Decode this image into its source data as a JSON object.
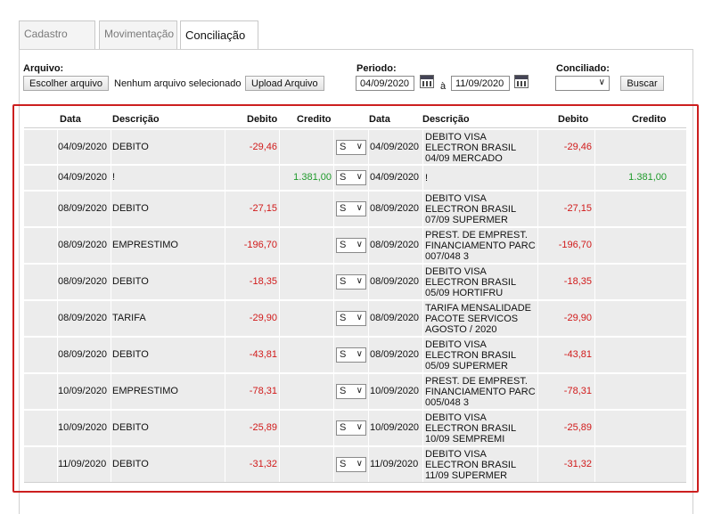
{
  "tabs": [
    {
      "label": "Cadastro",
      "active": false
    },
    {
      "label": "Movimentação",
      "active": false
    },
    {
      "label": "Conciliação",
      "active": true
    }
  ],
  "form": {
    "arquivo_label": "Arquivo:",
    "choose_file_button": "Escolher arquivo",
    "no_file_text": "Nenhum arquivo selecionado",
    "upload_button": "Upload Arquivo",
    "periodo_label": "Periodo:",
    "date_from": "04/09/2020",
    "date_separator": "à",
    "date_to": "11/09/2020",
    "conciliado_label": "Conciliado:",
    "conciliado_value": "",
    "buscar_button": "Buscar"
  },
  "table": {
    "headers": {
      "data": "Data",
      "descricao": "Descrição",
      "debito": "Debito",
      "credito": "Credito",
      "data2": "Data",
      "descricao2": "Descrição",
      "debito2": "Debito",
      "credito2": "Credito"
    },
    "rows": [
      {
        "date": "04/09/2020",
        "desc": "DEBITO",
        "debit": "-29,46",
        "credit": "",
        "match": "S",
        "date2": "04/09/2020",
        "desc2": [
          "DEBITO VISA",
          "ELECTRON BRASIL",
          "04/09 MERCADO"
        ],
        "debit2": "-29,46",
        "credit2": ""
      },
      {
        "date": "04/09/2020",
        "desc": "!",
        "debit": "",
        "credit": "1.381,00",
        "match": "S",
        "date2": "04/09/2020",
        "desc2": [
          "!"
        ],
        "debit2": "",
        "credit2": "1.381,00"
      },
      {
        "date": "08/09/2020",
        "desc": "DEBITO",
        "debit": "-27,15",
        "credit": "",
        "match": "S",
        "date2": "08/09/2020",
        "desc2": [
          "DEBITO VISA",
          "ELECTRON BRASIL",
          "07/09 SUPERMER"
        ],
        "debit2": "-27,15",
        "credit2": ""
      },
      {
        "date": "08/09/2020",
        "desc": "EMPRESTIMO",
        "debit": "-196,70",
        "credit": "",
        "match": "S",
        "date2": "08/09/2020",
        "desc2": [
          "PREST. DE EMPREST.",
          "FINANCIAMENTO PARC",
          "007/048 3"
        ],
        "debit2": "-196,70",
        "credit2": ""
      },
      {
        "date": "08/09/2020",
        "desc": "DEBITO",
        "debit": "-18,35",
        "credit": "",
        "match": "S",
        "date2": "08/09/2020",
        "desc2": [
          "DEBITO VISA",
          "ELECTRON BRASIL",
          "05/09 HORTIFRU"
        ],
        "debit2": "-18,35",
        "credit2": ""
      },
      {
        "date": "08/09/2020",
        "desc": "TARIFA",
        "debit": "-29,90",
        "credit": "",
        "match": "S",
        "date2": "08/09/2020",
        "desc2": [
          "TARIFA MENSALIDADE",
          "PACOTE SERVICOS",
          "AGOSTO / 2020"
        ],
        "debit2": "-29,90",
        "credit2": ""
      },
      {
        "date": "08/09/2020",
        "desc": "DEBITO",
        "debit": "-43,81",
        "credit": "",
        "match": "S",
        "date2": "08/09/2020",
        "desc2": [
          "DEBITO VISA",
          "ELECTRON BRASIL",
          "05/09 SUPERMER"
        ],
        "debit2": "-43,81",
        "credit2": ""
      },
      {
        "date": "10/09/2020",
        "desc": "EMPRESTIMO",
        "debit": "-78,31",
        "credit": "",
        "match": "S",
        "date2": "10/09/2020",
        "desc2": [
          "PREST. DE EMPREST.",
          "FINANCIAMENTO PARC",
          "005/048 3"
        ],
        "debit2": "-78,31",
        "credit2": ""
      },
      {
        "date": "10/09/2020",
        "desc": "DEBITO",
        "debit": "-25,89",
        "credit": "",
        "match": "S",
        "date2": "10/09/2020",
        "desc2": [
          "DEBITO VISA",
          "ELECTRON BRASIL",
          "10/09 SEMPREMI"
        ],
        "debit2": "-25,89",
        "credit2": ""
      },
      {
        "date": "11/09/2020",
        "desc": "DEBITO",
        "debit": "-31,32",
        "credit": "",
        "match": "S",
        "date2": "11/09/2020",
        "desc2": [
          "DEBITO VISA",
          "ELECTRON BRASIL",
          "11/09 SUPERMER"
        ],
        "debit2": "-31,32",
        "credit2": ""
      }
    ]
  },
  "colors": {
    "debit": "#d11a1a",
    "credit": "#1e9a2a",
    "highlight_border": "#cc1f1f",
    "row_bg": "#ececec"
  }
}
